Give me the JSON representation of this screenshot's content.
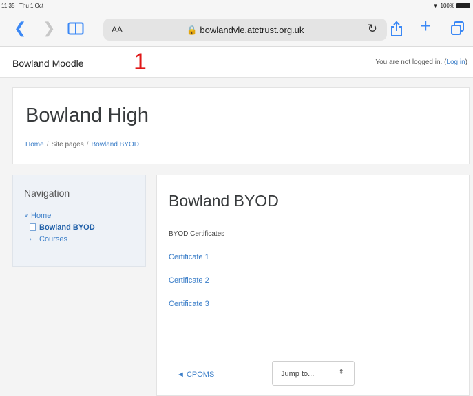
{
  "status_bar": {
    "time": "11:35",
    "date": "Thu 1 Oct",
    "battery": "100%"
  },
  "browser": {
    "text_size_label": "AA",
    "url": "bowlandvle.atctrust.org.uk",
    "accent_color": "#3b88f5"
  },
  "navbar": {
    "brand": "Bowland Moodle",
    "annotation": "1",
    "login_prefix": "You are not logged in. (",
    "login_link": "Log in",
    "login_suffix": ")"
  },
  "header": {
    "title": "Bowland High",
    "breadcrumb": [
      "Home",
      "Site pages",
      "Bowland BYOD"
    ]
  },
  "navigation": {
    "title": "Navigation",
    "items": [
      {
        "label": "Home",
        "level": 0
      },
      {
        "label": "Bowland BYOD",
        "level": 1
      },
      {
        "label": "Courses",
        "level": 1
      }
    ]
  },
  "main": {
    "title": "Bowland BYOD",
    "section_label": "BYOD Certificates",
    "links": [
      "Certificate 1",
      "Certificate 2",
      "Certificate 3"
    ],
    "prev_link": "◄ CPOMS",
    "jump_placeholder": "Jump to...",
    "link_color": "#3b7ec8"
  }
}
